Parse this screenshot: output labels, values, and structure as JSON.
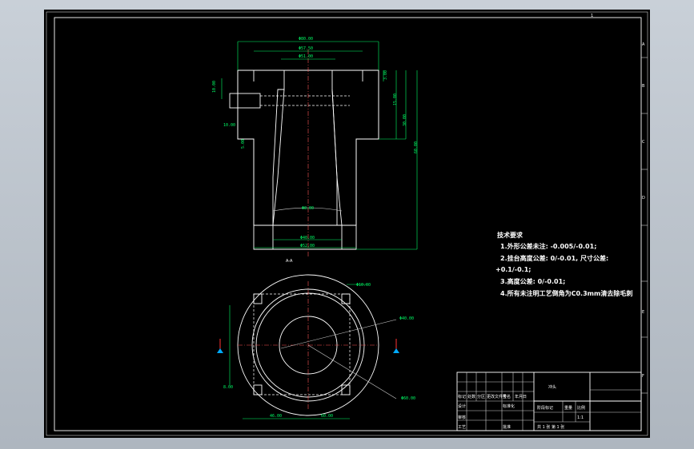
{
  "section_label": "A-A",
  "tech_requirements": {
    "title": "技术要求",
    "items": [
      "1.外形公差未注: -0.005/-0.01;",
      "2.挂台高度公差: 0/-0.01, 尺寸公差:",
      "+0.1/-0.1;",
      "3.高度公差: 0/-0.01;",
      "4.所有未注明工艺倒角为C0.3mm清去除毛刺"
    ]
  },
  "dimensions": {
    "top_width": "Φ80.00",
    "mid_width1": "Φ57.50",
    "mid_width2": "Φ51.00",
    "left_h1": "10.00",
    "left_h2": "10.00",
    "left_h3": "5.00",
    "right_h1": "3.00",
    "right_h2": "15.00",
    "right_h3": "30.00",
    "right_h4": "60.00",
    "bore": "Φ8.00",
    "bottom1": "Φ40.00",
    "bottom2": "Φ52.00",
    "plan_r1": "Φ10.00",
    "plan_r2": "Φ40.00",
    "plan_r3": "Φ60.00",
    "plan_left": "8.00",
    "plan_b1": "46.00",
    "plan_b2": "60.00"
  },
  "title_block": {
    "part_name": "冲头",
    "scale_label": "比例",
    "weight_label": "重量",
    "qty_label": "数量",
    "sheet": "共 1 张  第 1 张",
    "designer": "设计",
    "checker": "审核",
    "process": "工艺",
    "std": "标准化",
    "approve": "批准",
    "mark_label": "标记",
    "count_label": "处数",
    "zone_label": "分区",
    "doc_label": "更改文件号",
    "sign_label": "签名",
    "date_label": "年月日",
    "stage_label": "阶段标记",
    "scale_value": "1:1"
  },
  "border_letters": [
    "A",
    "B",
    "C",
    "D",
    "E",
    "F"
  ],
  "border_number": "1"
}
